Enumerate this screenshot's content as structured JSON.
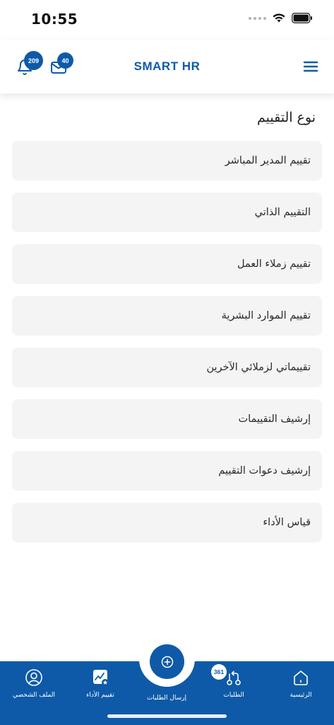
{
  "status_bar": {
    "time": "10:55",
    "icons": [
      "signal-dots-icon",
      "wifi-icon",
      "battery-icon"
    ]
  },
  "header": {
    "title": "SMART HR",
    "notifications_count": "209",
    "messages_count": "40",
    "icons": [
      "bell-icon",
      "mail-icon",
      "hamburger-menu-icon"
    ]
  },
  "section": {
    "title": "نوع التقييم"
  },
  "evaluation_types": [
    {
      "label": "تقييم المدير المباشر"
    },
    {
      "label": "التقييم الذاتي"
    },
    {
      "label": "تقييم زملاء العمل"
    },
    {
      "label": "تقييم الموارد البشرية"
    },
    {
      "label": "تقييماتي لزملائي الآخرين"
    },
    {
      "label": "إرشيف التقييمات"
    },
    {
      "label": "إرشيف دعوات التقييم"
    },
    {
      "label": "قياس الأداء"
    }
  ],
  "bottom_nav": {
    "home_label": "الرئيسية",
    "requests_label": "الطلبات",
    "requests_count": "361",
    "send_label": "إرسال الطلبات",
    "performance_label": "تقييم الأداء",
    "profile_label": "الملف الشخصي"
  },
  "colors": {
    "brand": "#0e5aa8",
    "card_background": "#f4f4f5"
  }
}
